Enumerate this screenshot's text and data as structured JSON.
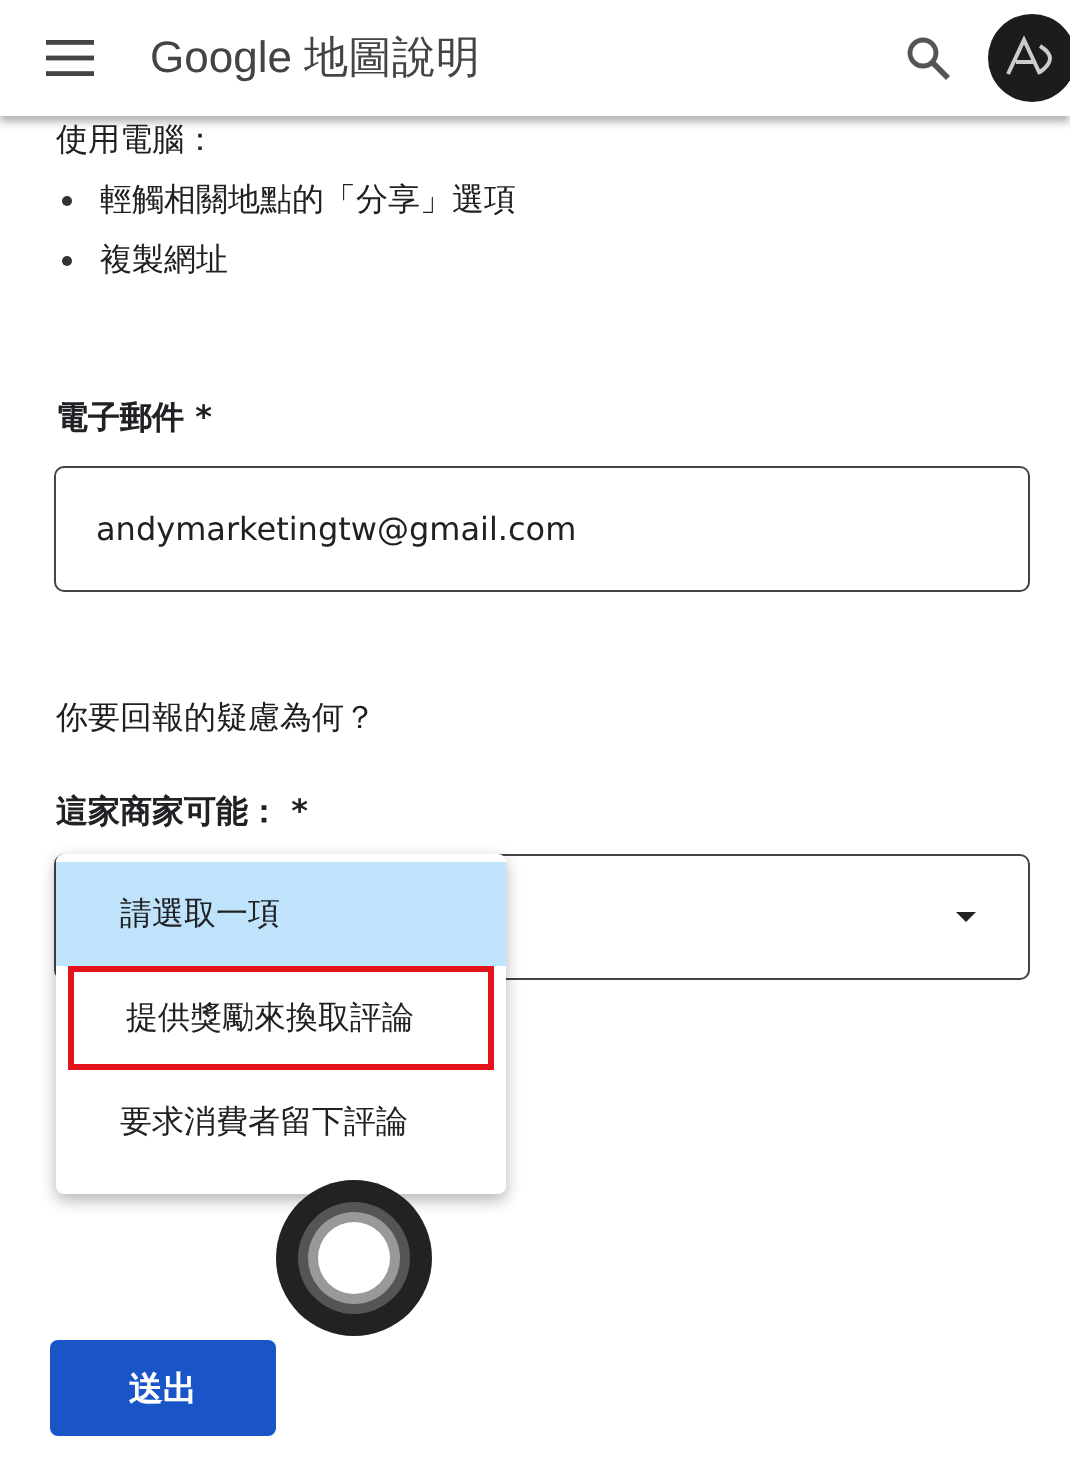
{
  "header": {
    "title": "Google 地圖說明"
  },
  "intro": {
    "heading": "使用電腦：",
    "bullets": [
      "輕觸相關地點的「分享」選項",
      "複製網址"
    ]
  },
  "email": {
    "label": "電子郵件 *",
    "value": "andymarketingtw@gmail.com"
  },
  "question": "你要回報的疑慮為何？",
  "business": {
    "label": "這家商家可能： *",
    "expanded": true,
    "options": [
      {
        "label": "請選取一項",
        "selected": true,
        "highlighted": false
      },
      {
        "label": "提供獎勵來換取評論",
        "selected": false,
        "highlighted": true
      },
      {
        "label": "要求消費者留下評論",
        "selected": false,
        "highlighted": false
      }
    ]
  },
  "submit": "送出"
}
